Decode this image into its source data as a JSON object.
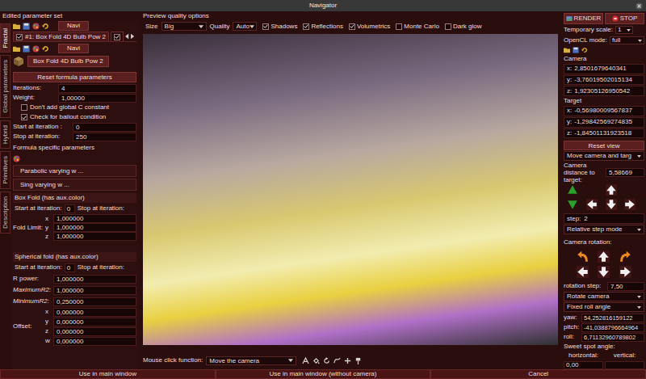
{
  "window": {
    "title": "Navigator"
  },
  "left": {
    "title": "Edited parameter set",
    "side_tabs": [
      {
        "label": "Fractal",
        "selected": true
      },
      {
        "label": "Global parameters",
        "selected": false
      },
      {
        "label": "Hybrid",
        "selected": false
      },
      {
        "label": "Primitives",
        "selected": false
      },
      {
        "label": "Description",
        "selected": false
      }
    ],
    "navi": [
      "Navi",
      "Navi"
    ],
    "formula_tabs": [
      {
        "label": "#1: Box Fold 4D Bulb Pow 2",
        "checked": true,
        "selected": true
      },
      {
        "checked": true,
        "selected": false
      }
    ],
    "formula_name": "Box Fold 4D Bulb Pow 2",
    "reset": "Reset formula parameters",
    "fields": [
      {
        "label": "Iterations:",
        "value": "4"
      },
      {
        "label": "Weight:",
        "value": "1,00000"
      }
    ],
    "checkboxes": [
      {
        "label": "Don't add global C constant",
        "checked": false
      },
      {
        "label": "Check for bailout condition",
        "checked": true
      }
    ],
    "iteration_range": [
      {
        "label": "Start at iteration :",
        "value": "0"
      },
      {
        "label": "Stop at iteration:",
        "value": "250"
      }
    ],
    "specific_title": "Formula specific parameters",
    "collapsed": [
      "Parabolic varying w ...",
      "Sing varying w ..."
    ],
    "box_fold": {
      "title": "Box Fold (has aux.color)",
      "start_label": "Start at iteration:",
      "start": "0",
      "stop_label": "Stop at iteration:",
      "limit_label": "Fold Limit:",
      "limit": [
        {
          "axis": "x",
          "value": "1,000000"
        },
        {
          "axis": "y",
          "value": "1,000000"
        },
        {
          "axis": "z",
          "value": "1,000000"
        }
      ]
    },
    "spherical_fold": {
      "title": "Spherical fold (has aux.color)",
      "start_label": "Start at iteration:",
      "start": "0",
      "stop_label": "Stop at iteration:",
      "params": [
        {
          "label": "R power:",
          "value": "1,000000"
        },
        {
          "label": "MaximumR2:",
          "value": "1,000000"
        },
        {
          "label": "MinimumR2:",
          "value": "0,250000"
        }
      ],
      "offset_label": "Offset:",
      "offset": [
        {
          "axis": "x",
          "value": "0,000000"
        },
        {
          "axis": "y",
          "value": "0,000000"
        },
        {
          "axis": "z",
          "value": "0,000000"
        },
        {
          "axis": "w",
          "value": "0,000000"
        }
      ]
    }
  },
  "preview": {
    "title": "Preview quality options",
    "size_label": "Size",
    "size": "Big",
    "quality_label": "Quality",
    "quality": "Auto",
    "options": [
      {
        "label": "Shadows",
        "checked": true
      },
      {
        "label": "Reflections",
        "checked": true
      },
      {
        "label": "Volumetrics",
        "checked": true
      },
      {
        "label": "Monte Carlo",
        "checked": false
      },
      {
        "label": "Dark glow",
        "checked": false
      }
    ]
  },
  "mouse": {
    "label": "Mouse click function:",
    "value": "Move the camera"
  },
  "right": {
    "render": "RENDER",
    "stop": "STOP",
    "scale_label": "Temporary scale:",
    "scale": "1",
    "opencl_label": "OpenCL mode:",
    "opencl": "full",
    "camera_title": "Camera",
    "camera": [
      {
        "axis": "x:",
        "value": "2,8501679640341"
      },
      {
        "axis": "y:",
        "value": "-3,76019502015134"
      },
      {
        "axis": "z:",
        "value": "1,92305126950542"
      }
    ],
    "target_title": "Target",
    "target": [
      {
        "axis": "x:",
        "value": "-0,56980009567837"
      },
      {
        "axis": "y:",
        "value": "-1,29842569274835"
      },
      {
        "axis": "z:",
        "value": "-1,84501131923518"
      }
    ],
    "reset_view": "Reset view",
    "move_mode": "Move camera and targ",
    "distance_label": "Camera distance to target:",
    "distance": "5,58669",
    "step_label": "step:",
    "step": "2",
    "step_mode": "Relative step mode",
    "rotation_title": "Camera rotation:",
    "rotation_step_label": "rotation step:",
    "rotation_step": "7,50",
    "rotate_mode": "Rotate camera",
    "roll_mode": "Fixed roll angle",
    "angles": [
      {
        "label": "yaw:",
        "value": "54,252816159122"
      },
      {
        "label": "pitch:",
        "value": "-41,0388796664964"
      },
      {
        "label": "roll:",
        "value": "6,71132960789802"
      }
    ],
    "sweet_title": "Sweet spot angle:",
    "horizontal_label": "horizontal:",
    "vertical_label": "vertical:",
    "horizontal": "0,00"
  },
  "footer": [
    "Use in main window",
    "Use in main window (without camera)",
    "Cancel"
  ]
}
